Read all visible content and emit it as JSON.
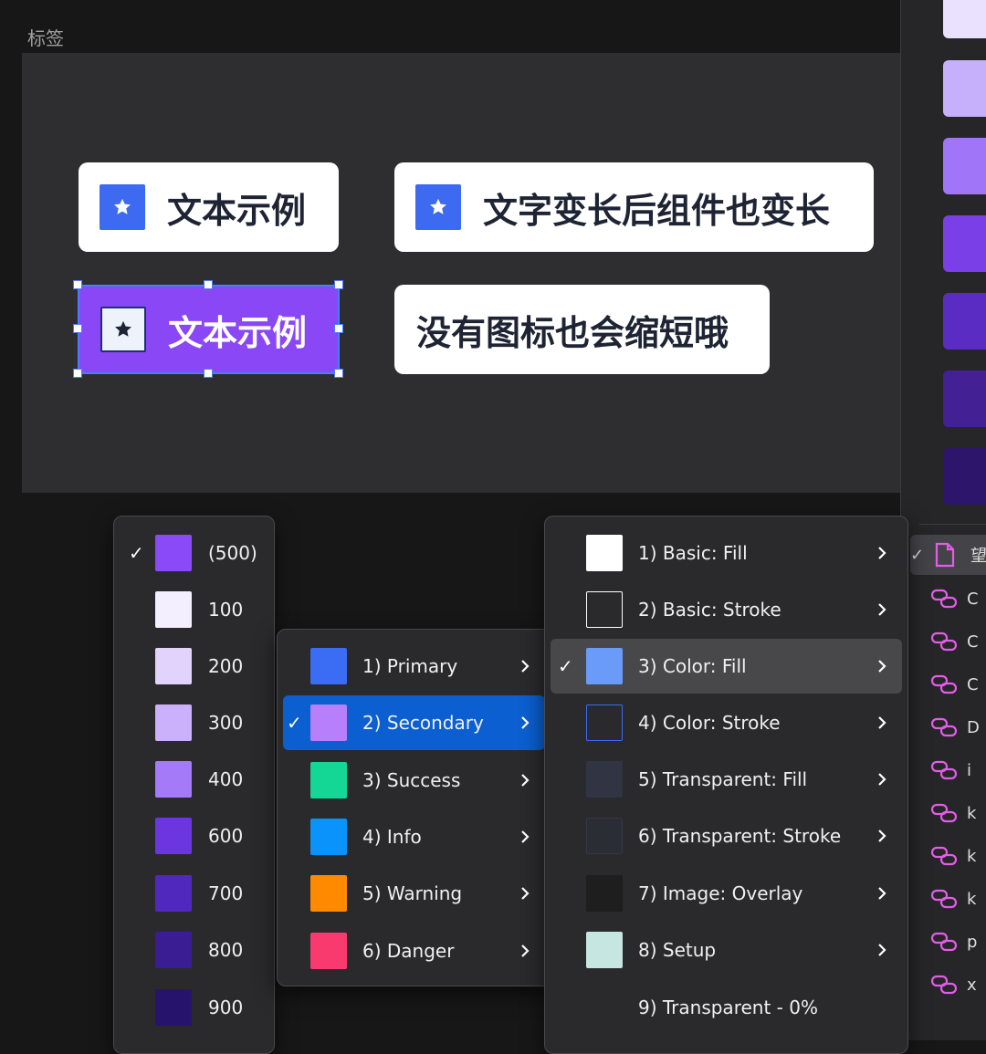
{
  "section_label": "标签",
  "tags": [
    {
      "label": "文本示例",
      "icon": "star-icon"
    },
    {
      "label": "文字变长后组件也变长",
      "icon": "star-icon"
    },
    {
      "label": "文本示例",
      "icon": "star-icon",
      "selected": true
    },
    {
      "label": "没有图标也会缩短哦"
    }
  ],
  "right_panel": {
    "swatches": [
      "#e9e1fd",
      "#c6b0fb",
      "#a175f7",
      "#7a3fe6",
      "#5b2cc4",
      "#432195",
      "#2c156a"
    ],
    "items": [
      {
        "label": "望",
        "icon": "document-icon",
        "selected": true
      },
      {
        "label": "C",
        "icon": "link-icon"
      },
      {
        "label": "C",
        "icon": "link-icon"
      },
      {
        "label": "C",
        "icon": "link-icon"
      },
      {
        "label": "D",
        "icon": "link-icon"
      },
      {
        "label": "i",
        "icon": "link-icon"
      },
      {
        "label": "k",
        "icon": "link-icon"
      },
      {
        "label": "k",
        "icon": "link-icon"
      },
      {
        "label": "k",
        "icon": "link-icon"
      },
      {
        "label": "p",
        "icon": "link-icon"
      },
      {
        "label": "x",
        "icon": "link-icon"
      }
    ]
  },
  "shade_menu": [
    {
      "label": "(500)",
      "color": "#8a4af7",
      "checked": true
    },
    {
      "label": "100",
      "color": "#f4effe"
    },
    {
      "label": "200",
      "color": "#e2d3fc"
    },
    {
      "label": "300",
      "color": "#cbb0fb"
    },
    {
      "label": "400",
      "color": "#a57af9"
    },
    {
      "label": "600",
      "color": "#6b36e0"
    },
    {
      "label": "700",
      "color": "#5128bd"
    },
    {
      "label": "800",
      "color": "#3a1d93"
    },
    {
      "label": "900",
      "color": "#26136b"
    }
  ],
  "palette_menu": [
    {
      "label": "1) Primary",
      "color": "#3a6cf4"
    },
    {
      "label": "2) Secondary",
      "color": "#b77ffa",
      "checked": true,
      "highlight": true
    },
    {
      "label": "3) Success",
      "color": "#14d695"
    },
    {
      "label": "4) Info",
      "color": "#0a93fb"
    },
    {
      "label": "5) Warning",
      "color": "#ff8a00"
    },
    {
      "label": "6) Danger",
      "color": "#f93a6e"
    }
  ],
  "style_menu": [
    {
      "label": "1) Basic: Fill",
      "color": "#ffffff",
      "kind": "fill"
    },
    {
      "label": "2) Basic: Stroke",
      "color": "#ffffff",
      "kind": "stroke"
    },
    {
      "label": "3) Color: Fill",
      "color": "#6a9bf8",
      "kind": "fill",
      "checked": true,
      "highlight": true
    },
    {
      "label": "4) Color: Stroke",
      "color": "#3a6cf4",
      "kind": "stroke"
    },
    {
      "label": "5) Transparent: Fill",
      "color": "#313442",
      "kind": "fill"
    },
    {
      "label": "6) Transparent: Stroke",
      "color": "#2b2d35",
      "kind": "fill"
    },
    {
      "label": "7) Image: Overlay",
      "color": "#1e1e1e",
      "kind": "fill"
    },
    {
      "label": "8) Setup",
      "color": "#c6e6e2",
      "kind": "fill"
    },
    {
      "label": "9) Transparent - 0%",
      "kind": "none"
    }
  ]
}
